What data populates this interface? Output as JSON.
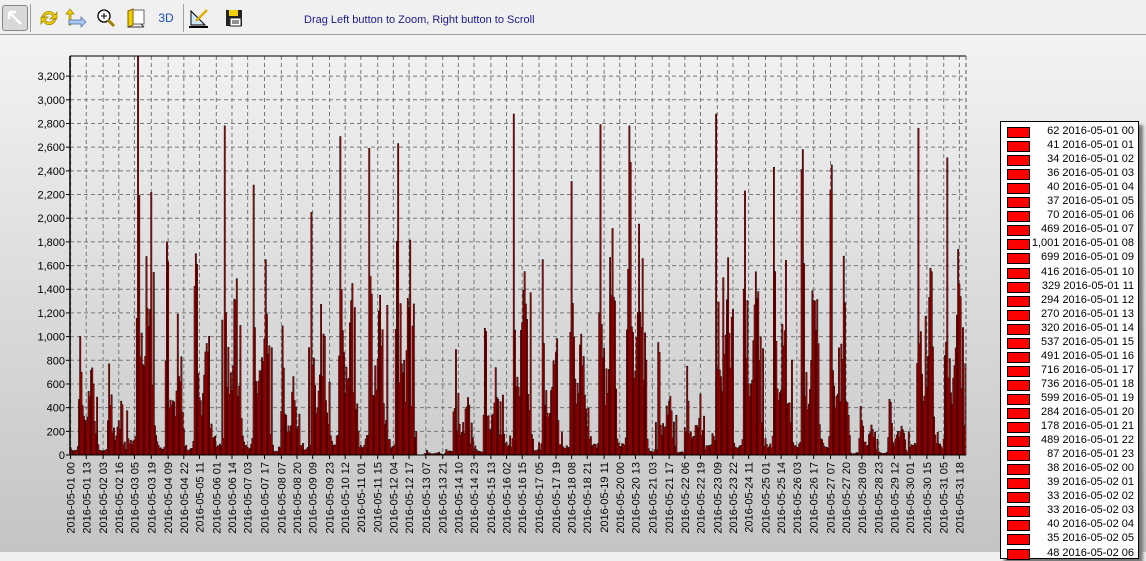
{
  "toolbar": {
    "buttons": [
      {
        "name": "pointer-button",
        "icon": "arrow-pointer-icon"
      },
      {
        "name": "refresh-button",
        "icon": "refresh-icon"
      },
      {
        "name": "axis-button",
        "icon": "axis-arrows-icon"
      },
      {
        "name": "zoom-button",
        "icon": "magnifier-icon"
      },
      {
        "name": "page-button",
        "icon": "page-icon"
      },
      {
        "name": "3d-button",
        "label": "3D"
      },
      {
        "name": "edit-button",
        "icon": "pen-ruler-icon"
      },
      {
        "name": "save-button",
        "icon": "floppy-icon"
      }
    ],
    "hint": "Drag Left button to Zoom, Right button to Scroll"
  },
  "chart_data": {
    "type": "bar",
    "title": "",
    "xlabel": "",
    "ylabel": "",
    "ylim": [
      0,
      3370
    ],
    "yticks": [
      "0",
      "200",
      "400",
      "600",
      "800",
      "1,000",
      "1,200",
      "1,400",
      "1,600",
      "1,800",
      "2,000",
      "2,200",
      "2,400",
      "2,600",
      "2,800",
      "3,000",
      "3,200"
    ],
    "grid": true,
    "bar_color": "#ff0000",
    "bar_edge_color": "#000000",
    "x_start": "2016-05-01 00",
    "hours_total": 744,
    "xticks": [
      "2016-05-01 00",
      "2016-05-01 13",
      "2016-05-02 03",
      "2016-05-02 16",
      "2016-05-03 05",
      "2016-05-03 19",
      "2016-05-04 09",
      "2016-05-04 22",
      "2016-05-05 11",
      "2016-05-06 01",
      "2016-05-06 14",
      "2016-05-07 03",
      "2016-05-07 17",
      "2016-05-08 07",
      "2016-05-08 20",
      "2016-05-09 09",
      "2016-05-09 23",
      "2016-05-10 12",
      "2016-05-11 01",
      "2016-05-11 15",
      "2016-05-12 04",
      "2016-05-12 17",
      "2016-05-13 07",
      "2016-05-13 21",
      "2016-05-14 10",
      "2016-05-14 23",
      "2016-05-15 13",
      "2016-05-16 02",
      "2016-05-16 15",
      "2016-05-17 05",
      "2016-05-17 19",
      "2016-05-18 08",
      "2016-05-18 21",
      "2016-05-19 11",
      "2016-05-20 00",
      "2016-05-20 13",
      "2016-05-21 03",
      "2016-05-21 17",
      "2016-05-22 06",
      "2016-05-22 19",
      "2016-05-23 09",
      "2016-05-23 22",
      "2016-05-24 11",
      "2016-05-25 01",
      "2016-05-25 14",
      "2016-05-26 03",
      "2016-05-26 17",
      "2016-05-27 07",
      "2016-05-27 20",
      "2016-05-28 09",
      "2016-05-28 23",
      "2016-05-29 12",
      "2016-05-30 01",
      "2016-05-30 15",
      "2016-05-31 05",
      "2016-05-31 18"
    ],
    "daily_peak_estimates": [
      1001,
      770,
      3370,
      1800,
      1700,
      2780,
      2280,
      1090,
      2050,
      2690,
      2590,
      2630,
      40,
      890,
      1070,
      2880,
      1650,
      2310,
      2790,
      2780,
      950,
      750,
      2880,
      2230,
      2430,
      2580,
      2450,
      410,
      470,
      2760,
      2510
    ],
    "legend": {
      "placement": "right",
      "entries": [
        {
          "value": "62",
          "label": "2016-05-01 00"
        },
        {
          "value": "41",
          "label": "2016-05-01 01"
        },
        {
          "value": "34",
          "label": "2016-05-01 02"
        },
        {
          "value": "36",
          "label": "2016-05-01 03"
        },
        {
          "value": "40",
          "label": "2016-05-01 04"
        },
        {
          "value": "37",
          "label": "2016-05-01 05"
        },
        {
          "value": "70",
          "label": "2016-05-01 06"
        },
        {
          "value": "469",
          "label": "2016-05-01 07"
        },
        {
          "value": "1,001",
          "label": "2016-05-01 08"
        },
        {
          "value": "699",
          "label": "2016-05-01 09"
        },
        {
          "value": "416",
          "label": "2016-05-01 10"
        },
        {
          "value": "329",
          "label": "2016-05-01 11"
        },
        {
          "value": "294",
          "label": "2016-05-01 12"
        },
        {
          "value": "270",
          "label": "2016-05-01 13"
        },
        {
          "value": "320",
          "label": "2016-05-01 14"
        },
        {
          "value": "537",
          "label": "2016-05-01 15"
        },
        {
          "value": "491",
          "label": "2016-05-01 16"
        },
        {
          "value": "716",
          "label": "2016-05-01 17"
        },
        {
          "value": "736",
          "label": "2016-05-01 18"
        },
        {
          "value": "599",
          "label": "2016-05-01 19"
        },
        {
          "value": "284",
          "label": "2016-05-01 20"
        },
        {
          "value": "178",
          "label": "2016-05-01 21"
        },
        {
          "value": "489",
          "label": "2016-05-01 22"
        },
        {
          "value": "87",
          "label": "2016-05-01 23"
        },
        {
          "value": "38",
          "label": "2016-05-02 00"
        },
        {
          "value": "39",
          "label": "2016-05-02 01"
        },
        {
          "value": "33",
          "label": "2016-05-02 02"
        },
        {
          "value": "33",
          "label": "2016-05-02 03"
        },
        {
          "value": "40",
          "label": "2016-05-02 04"
        },
        {
          "value": "35",
          "label": "2016-05-02 05"
        },
        {
          "value": "48",
          "label": "2016-05-02 06"
        }
      ]
    }
  }
}
